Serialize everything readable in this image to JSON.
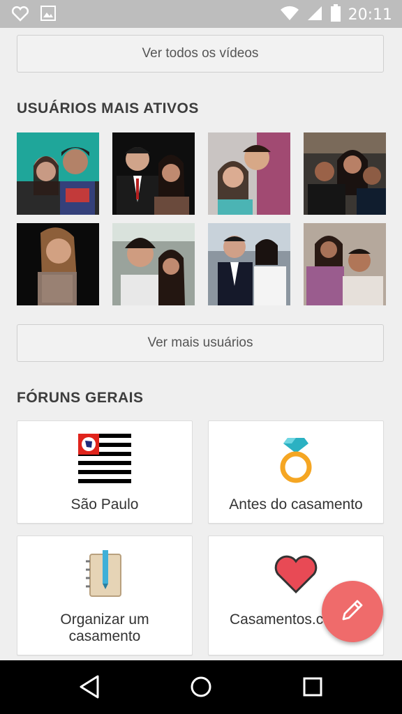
{
  "status_bar": {
    "time": "20:11",
    "icons": [
      "heart-outline-icon",
      "image-icon",
      "wifi-icon",
      "signal-icon",
      "battery-icon"
    ]
  },
  "videos": {
    "see_all_label": "Ver todos os vídeos"
  },
  "active_users": {
    "title": "USUÁRIOS MAIS ATIVOS",
    "see_more_label": "Ver mais usuários",
    "avatars": [
      "couple-photo-1",
      "couple-photo-2",
      "couple-photo-3",
      "couple-photo-4",
      "woman-photo-5",
      "couple-photo-6",
      "couple-photo-7",
      "couple-photo-8"
    ]
  },
  "forums": {
    "title": "FÓRUNS GERAIS",
    "items": [
      {
        "label": "São Paulo",
        "icon": "sao-paulo-flag-icon"
      },
      {
        "label": "Antes do casamento",
        "icon": "ring-icon"
      },
      {
        "label": "Organizar um casamento",
        "label_line1": "Organizar um",
        "label_line2": "casamento",
        "icon": "notebook-icon"
      },
      {
        "label": "Casamentos.c",
        "icon": "heart-icon"
      }
    ]
  },
  "fab": {
    "icon": "pencil-icon"
  },
  "nav": {
    "icons": [
      "back-icon",
      "home-icon",
      "recents-icon"
    ]
  },
  "colors": {
    "fab": "#ef6b6b",
    "status_bar": "#bdbdbd",
    "background": "#efefef"
  }
}
